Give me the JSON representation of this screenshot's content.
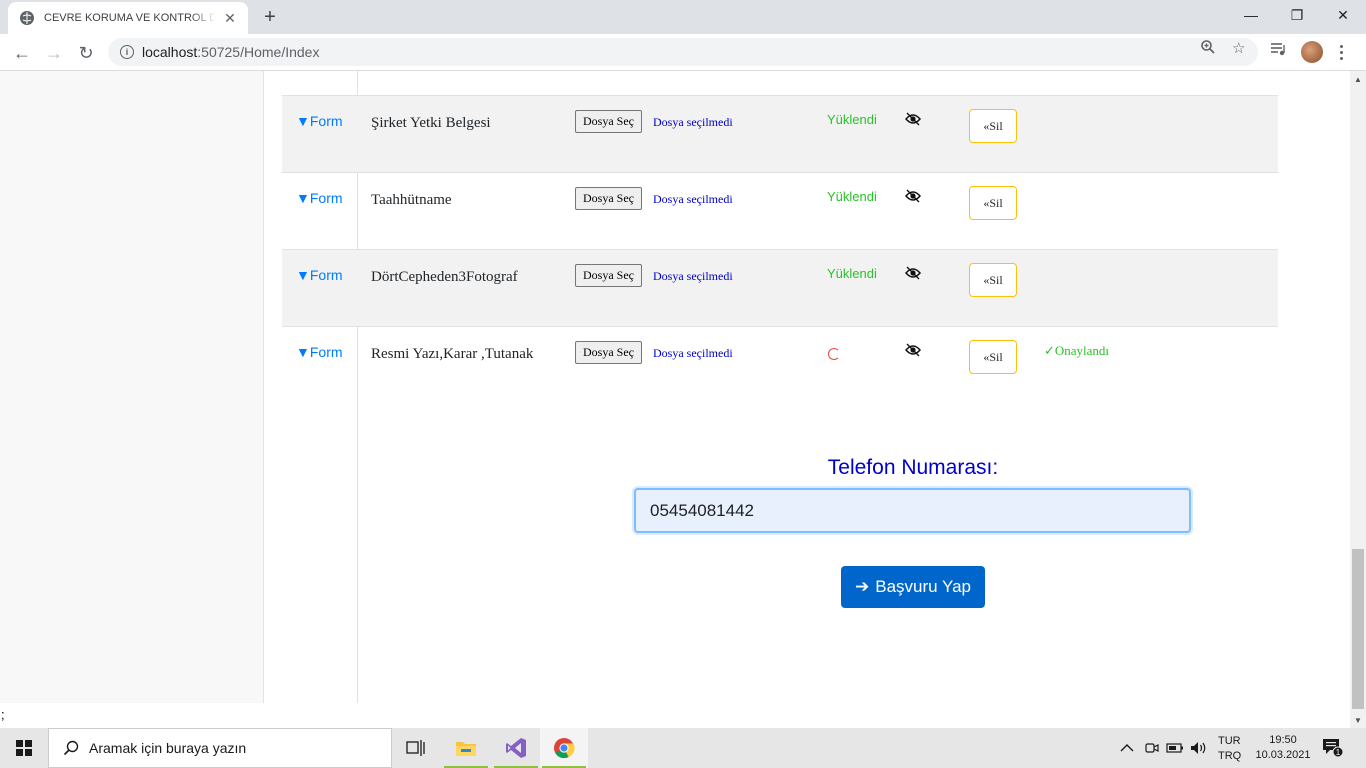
{
  "browser": {
    "tab_title": "CEVRE KORUMA VE KONTROL DAIRESI",
    "url_host": "localhost",
    "url_path": ":50725/Home/Index"
  },
  "documents": [
    {
      "form_label": "▼Form",
      "name": "Şirket Yetki Belgesi",
      "file_button": "Dosya Seç",
      "file_status": "Dosya seçilmedi",
      "upload_status": "Yüklendi",
      "delete_label": "«Sil",
      "approval": ""
    },
    {
      "form_label": "▼Form",
      "name": "Taahhütname",
      "file_button": "Dosya Seç",
      "file_status": "Dosya seçilmedi",
      "upload_status": "Yüklendi",
      "delete_label": "«Sil",
      "approval": ""
    },
    {
      "form_label": "▼Form",
      "name": "DörtCepheden3Fotograf",
      "file_button": "Dosya Seç",
      "file_status": "Dosya seçilmedi",
      "upload_status": "Yüklendi",
      "delete_label": "«Sil",
      "approval": ""
    },
    {
      "form_label": "▼Form",
      "name": "Resmi Yazı,Karar ,Tutanak",
      "file_button": "Dosya Seç",
      "file_status": "Dosya seçilmedi",
      "upload_status": "",
      "delete_label": "«Sil",
      "approval": "✓Onaylandı"
    }
  ],
  "phone": {
    "label": "Telefon Numarası:",
    "value": "05454081442"
  },
  "submit": {
    "arrow": "➔",
    "label": "Başvuru Yap"
  },
  "status_bar_text": ";",
  "taskbar": {
    "search_placeholder": "Aramak için buraya yazın",
    "lang_top": "TUR",
    "lang_bottom": "TRQ",
    "time": "19:50",
    "date": "10.03.2021",
    "notification_count": "1"
  },
  "colors": {
    "link_blue": "#007bff",
    "heading_blue": "#0000cd",
    "success_green": "#28c228",
    "primary_button": "#0066cc",
    "warning_border": "#ffc107"
  }
}
